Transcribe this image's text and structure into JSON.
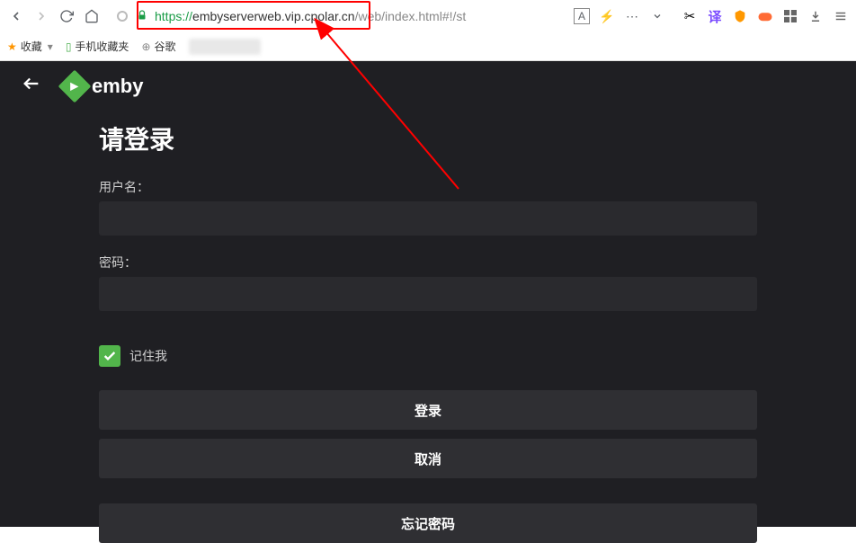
{
  "browser": {
    "url_protocol": "https://",
    "url_host": "embyserverweb.vip.cpolar.cn",
    "url_path": "/web/index.html#!/st"
  },
  "bookmarks": {
    "favorites": "收藏",
    "mobile": "手机收藏夹",
    "google": "谷歌"
  },
  "logo": {
    "text": "emby"
  },
  "form": {
    "title": "请登录",
    "username_label": "用户名",
    "password_label": "密码",
    "remember_label": "记住我",
    "login_button": "登录",
    "cancel_button": "取消",
    "forgot_button": "忘记密码"
  }
}
